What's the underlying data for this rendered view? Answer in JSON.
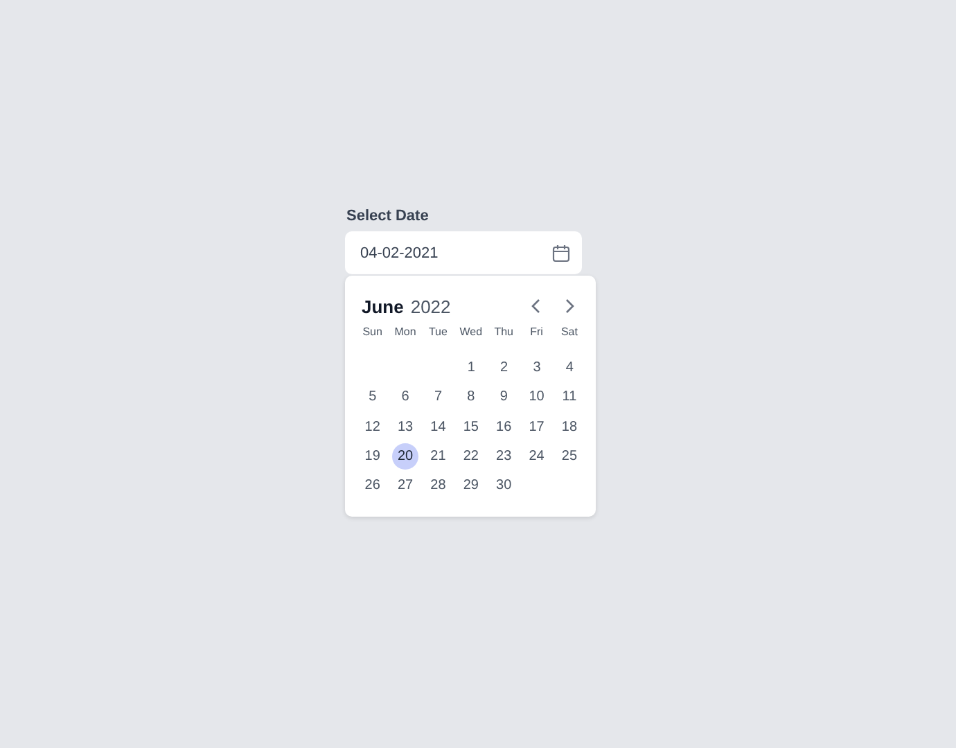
{
  "field": {
    "label": "Select Date",
    "value": "04-02-2021"
  },
  "calendar": {
    "month": "June",
    "year": "2022",
    "weekdays": [
      "Sun",
      "Mon",
      "Tue",
      "Wed",
      "Thu",
      "Fri",
      "Sat"
    ],
    "weeks": [
      {
        "right_aligned": true,
        "days": [
          {
            "label": "1",
            "selected": false
          },
          {
            "label": "2",
            "selected": false
          },
          {
            "label": "3",
            "selected": false
          },
          {
            "label": "4",
            "selected": false
          }
        ]
      },
      [
        {
          "label": "5",
          "selected": false
        },
        {
          "label": "6",
          "selected": false
        },
        {
          "label": "7",
          "selected": false
        },
        {
          "label": "8",
          "selected": false
        },
        {
          "label": "9",
          "selected": false
        },
        {
          "label": "10",
          "selected": false
        },
        {
          "label": "11",
          "selected": false
        }
      ],
      [
        {
          "label": "12",
          "selected": false
        },
        {
          "label": "13",
          "selected": false
        },
        {
          "label": "14",
          "selected": false
        },
        {
          "label": "15",
          "selected": false
        },
        {
          "label": "16",
          "selected": false
        },
        {
          "label": "17",
          "selected": false
        },
        {
          "label": "18",
          "selected": false
        }
      ],
      [
        {
          "label": "19",
          "selected": false
        },
        {
          "label": "20",
          "selected": true
        },
        {
          "label": "21",
          "selected": false
        },
        {
          "label": "22",
          "selected": false
        },
        {
          "label": "23",
          "selected": false
        },
        {
          "label": "24",
          "selected": false
        },
        {
          "label": "25",
          "selected": false
        }
      ],
      [
        {
          "label": "26",
          "selected": false
        },
        {
          "label": "27",
          "selected": false
        },
        {
          "label": "28",
          "selected": false
        },
        {
          "label": "29",
          "selected": false
        },
        {
          "label": "30",
          "selected": false
        }
      ]
    ]
  }
}
